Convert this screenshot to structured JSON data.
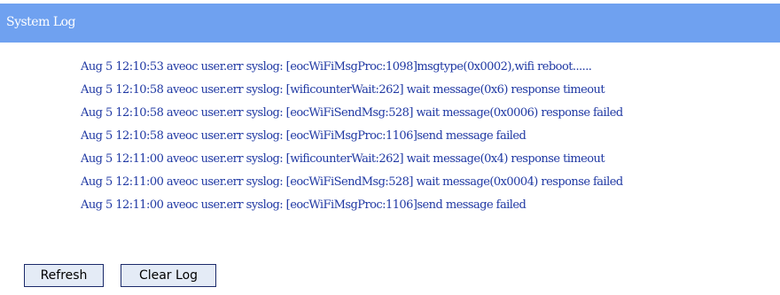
{
  "header": {
    "title": "System Log"
  },
  "log": {
    "lines": [
      "Aug 5 12:10:53 aveoc user.err syslog: [eocWiFiMsgProc:1098]msgtype(0x0002),wifi reboot......",
      "Aug 5 12:10:58 aveoc user.err syslog: [wificounterWait:262] wait message(0x6) response timeout",
      "Aug 5 12:10:58 aveoc user.err syslog: [eocWiFiSendMsg:528] wait message(0x0006) response failed",
      "Aug 5 12:10:58 aveoc user.err syslog: [eocWiFiMsgProc:1106]send message failed",
      "Aug 5 12:11:00 aveoc user.err syslog: [wificounterWait:262] wait message(0x4) response timeout",
      "Aug 5 12:11:00 aveoc user.err syslog: [eocWiFiSendMsg:528] wait message(0x0004) response failed",
      "Aug 5 12:11:00 aveoc user.err syslog: [eocWiFiMsgProc:1106]send message failed"
    ]
  },
  "buttons": {
    "refresh": "Refresh",
    "clear_log": "Clear Log"
  },
  "colors": {
    "header_bg": "#6fa1f0",
    "header_text": "#ffffff",
    "log_text": "#1f38a3",
    "button_bg": "#e4ebf6",
    "button_border": "#1b2a6a"
  }
}
